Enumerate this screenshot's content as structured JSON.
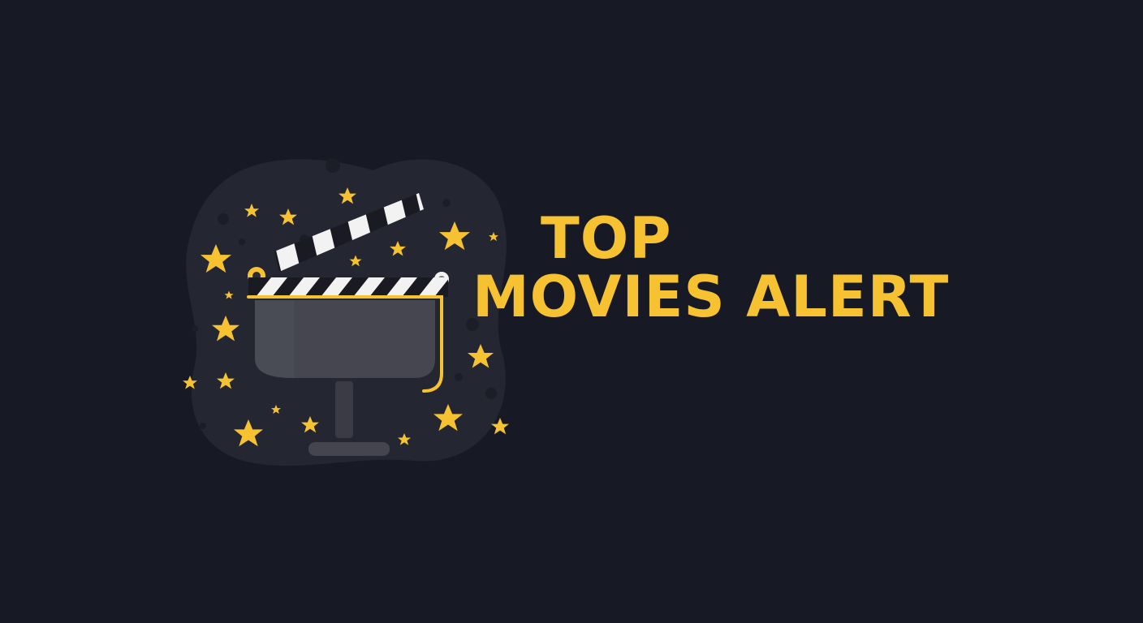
{
  "brand": {
    "title_line1": "TOP",
    "title_line2": "MOVIES ALERT",
    "logo_icon": "clapperboard-icon",
    "decor_icon": "star-icon"
  },
  "colors": {
    "background": "#171a25",
    "accent": "#f6c232",
    "board": "#454650",
    "board_dark": "#35363f",
    "stripe_light": "#f2f2f2",
    "stripe_dark": "#1a1b22",
    "blob": "#242631"
  }
}
